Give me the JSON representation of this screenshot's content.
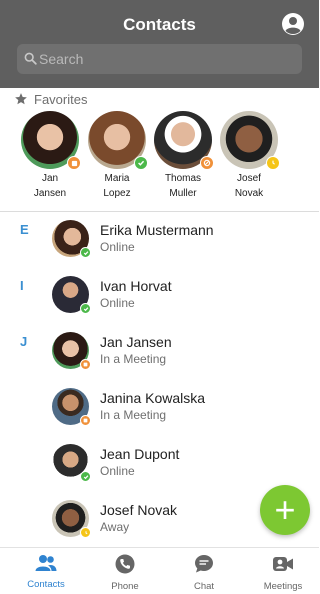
{
  "header": {
    "title": "Contacts",
    "account_icon": "account-circle-icon",
    "bg_color": "#5f5f5f"
  },
  "search": {
    "placeholder": "Search",
    "icon": "search-icon"
  },
  "favorites": {
    "title": "Favorites",
    "icon": "star-icon",
    "items": [
      {
        "first": "Jan",
        "last": "Jansen",
        "status": "in-meeting"
      },
      {
        "first": "Maria",
        "last": "Lopez",
        "status": "online"
      },
      {
        "first": "Thomas",
        "last": "Muller",
        "status": "busy"
      },
      {
        "first": "Josef",
        "last": "Novak",
        "status": "away"
      }
    ]
  },
  "contacts": [
    {
      "letter": "E",
      "name": "Erika Mustermann",
      "status": "Online"
    },
    {
      "letter": "I",
      "name": "Ivan Horvat",
      "status": "Online"
    },
    {
      "letter": "J",
      "name": "Jan Jansen",
      "status": "In a Meeting"
    },
    {
      "letter": "",
      "name": "Janina Kowalska",
      "status": "In a Meeting"
    },
    {
      "letter": "",
      "name": "Jean Dupont",
      "status": "Online"
    },
    {
      "letter": "",
      "name": "Josef Novak",
      "status": "Away"
    }
  ],
  "fab": {
    "label": "+",
    "color": "#7dc832"
  },
  "tabs": [
    {
      "label": "Contacts",
      "icon": "people-icon",
      "active": true
    },
    {
      "label": "Phone",
      "icon": "phone-icon",
      "active": false
    },
    {
      "label": "Chat",
      "icon": "chat-icon",
      "active": false
    },
    {
      "label": "Meetings",
      "icon": "video-camera-icon",
      "active": false
    }
  ],
  "colors": {
    "accent": "#2f83d0",
    "letter": "#3a8fd1",
    "online": "#4cb84a",
    "meeting": "#f0913a",
    "busy": "#f0913a",
    "away": "#f5c518"
  }
}
